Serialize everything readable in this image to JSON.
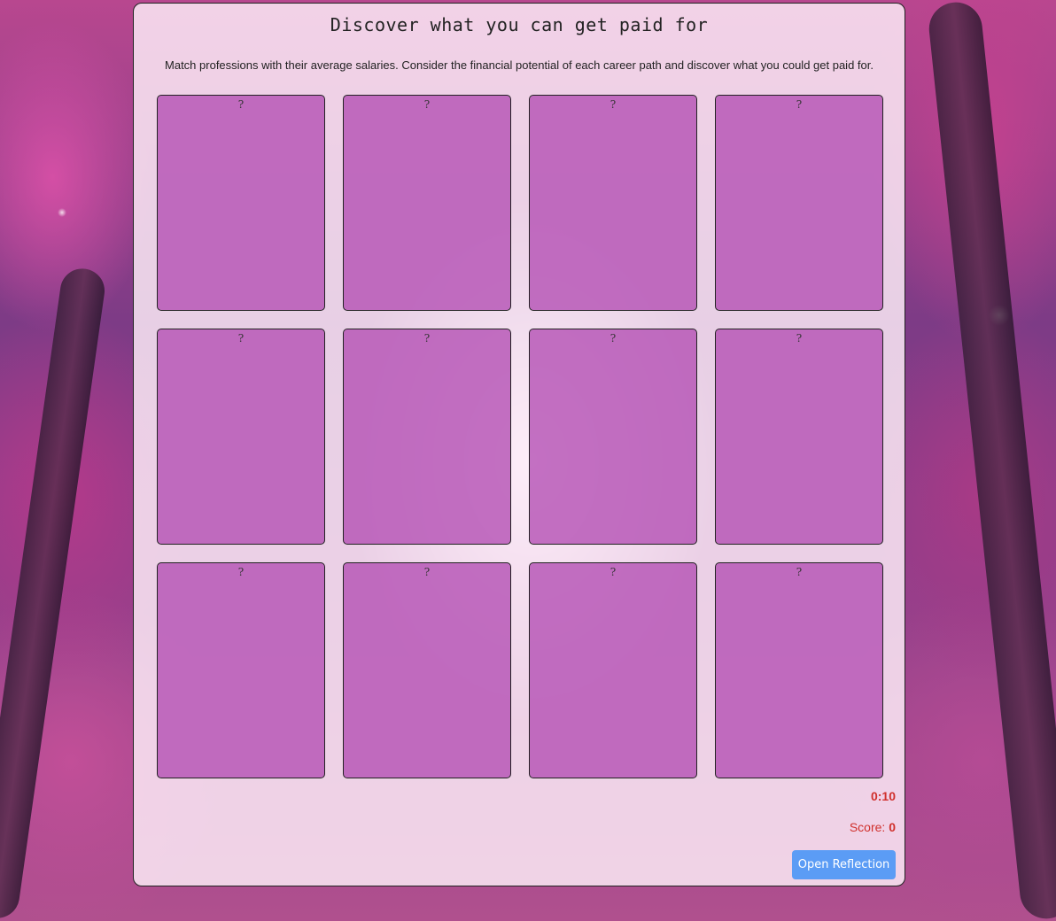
{
  "game": {
    "title": "Discover what you can get paid for",
    "instructions": "Match professions with their average salaries. Consider the financial potential of each career path and discover what you could get paid for."
  },
  "cards": [
    {
      "label": "?"
    },
    {
      "label": "?"
    },
    {
      "label": "?"
    },
    {
      "label": "?"
    },
    {
      "label": "?"
    },
    {
      "label": "?"
    },
    {
      "label": "?"
    },
    {
      "label": "?"
    },
    {
      "label": "?"
    },
    {
      "label": "?"
    },
    {
      "label": "?"
    },
    {
      "label": "?"
    }
  ],
  "status": {
    "timer": "0:10",
    "score_label": "Score:",
    "score_value": "0"
  },
  "actions": {
    "open_reflection_label": "Open Reflection"
  },
  "colors": {
    "card_back": "#b450b4",
    "accent_text": "#d0302c",
    "button": "#5b9cf5"
  }
}
